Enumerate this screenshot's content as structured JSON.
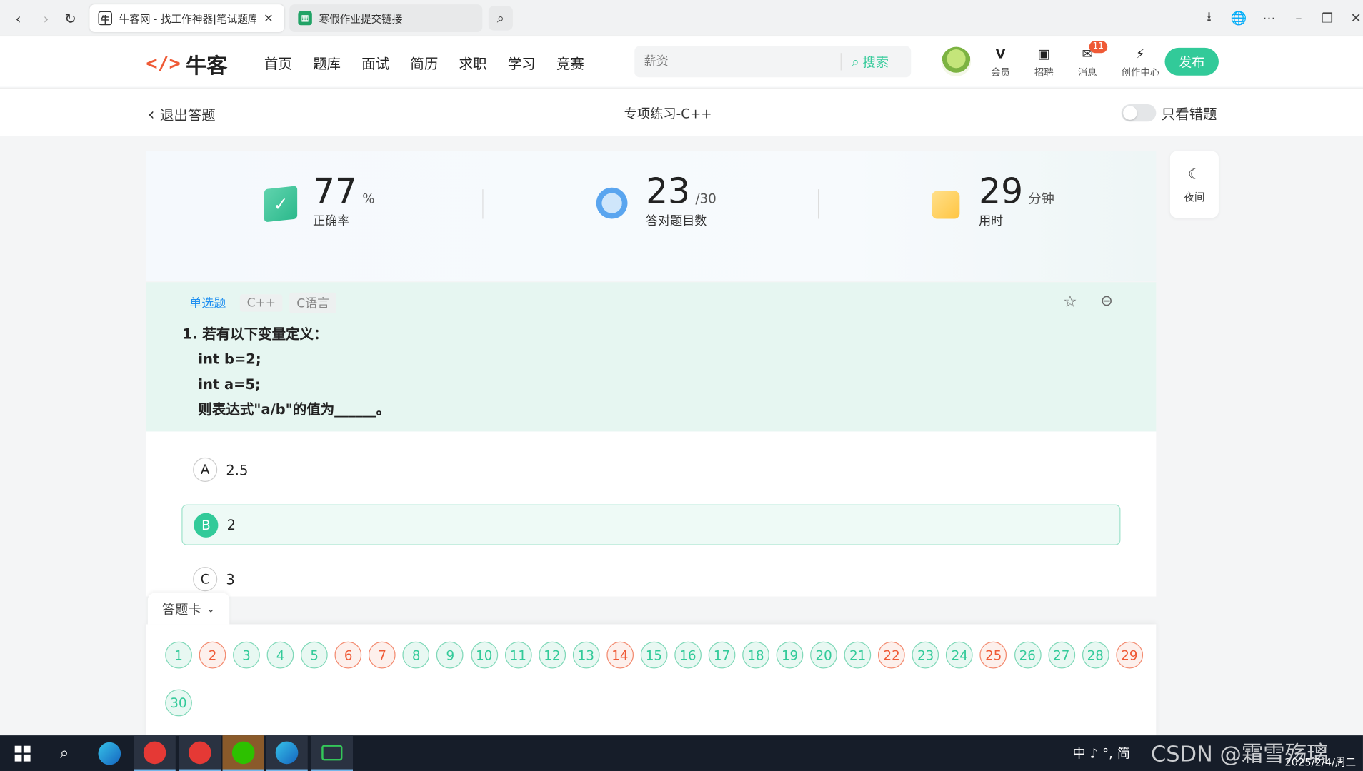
{
  "browser": {
    "tabs": [
      {
        "title": "牛客网 - 找工作神器|笔试题库",
        "active": true
      },
      {
        "title": "寒假作业提交链接",
        "active": false
      }
    ],
    "close_icon": "×"
  },
  "site": {
    "logo_text": "牛客",
    "nav": [
      "首页",
      "题库",
      "面试",
      "简历",
      "求职",
      "学习",
      "竞赛"
    ],
    "search_placeholder": "薪资",
    "search_button": "搜索",
    "icons": [
      {
        "label": "会员",
        "icon": "vip-icon"
      },
      {
        "label": "招聘",
        "icon": "recruit-icon"
      },
      {
        "label": "消息",
        "icon": "message-icon",
        "badge": "11"
      },
      {
        "label": "创作中心",
        "icon": "creation-icon"
      }
    ],
    "publish": "发布",
    "accent": "#32ca99"
  },
  "subbar": {
    "back": "退出答题",
    "title": "专项练习-C++",
    "wrong_only": "只看错题"
  },
  "stats": [
    {
      "value": "77",
      "unit": "%",
      "label": "正确率"
    },
    {
      "value": "23",
      "unit": "/30",
      "label": "答对题目数"
    },
    {
      "value": "29",
      "unit": "分钟",
      "label": "用时"
    }
  ],
  "night": "夜间",
  "question": {
    "tags": [
      "单选题",
      "C++",
      "C语言"
    ],
    "lines": [
      "1. 若有以下变量定义：",
      "int b=2;",
      "int a=5;",
      "则表达式\"a/b\"的值为______。"
    ],
    "options": [
      {
        "letter": "A",
        "text": "2.5",
        "selected": false
      },
      {
        "letter": "B",
        "text": "2",
        "selected": true
      },
      {
        "letter": "C",
        "text": "3",
        "selected": false
      }
    ]
  },
  "answer_card": {
    "title": "答题卡",
    "numbers": [
      "1",
      "2",
      "3",
      "4",
      "5",
      "6",
      "7",
      "8",
      "9",
      "10",
      "11",
      "12",
      "13",
      "14",
      "15",
      "16",
      "17",
      "18",
      "19",
      "20",
      "21",
      "22",
      "23",
      "24",
      "25",
      "26",
      "27",
      "28",
      "29",
      "30"
    ],
    "wrong": [
      "2",
      "6",
      "7",
      "14",
      "22",
      "25",
      "29"
    ]
  },
  "taskbar": {
    "tray": "中 ♪ °, 简",
    "date": "2025/2/4/周二",
    "watermark": "CSDN @霜雪殇璃"
  }
}
